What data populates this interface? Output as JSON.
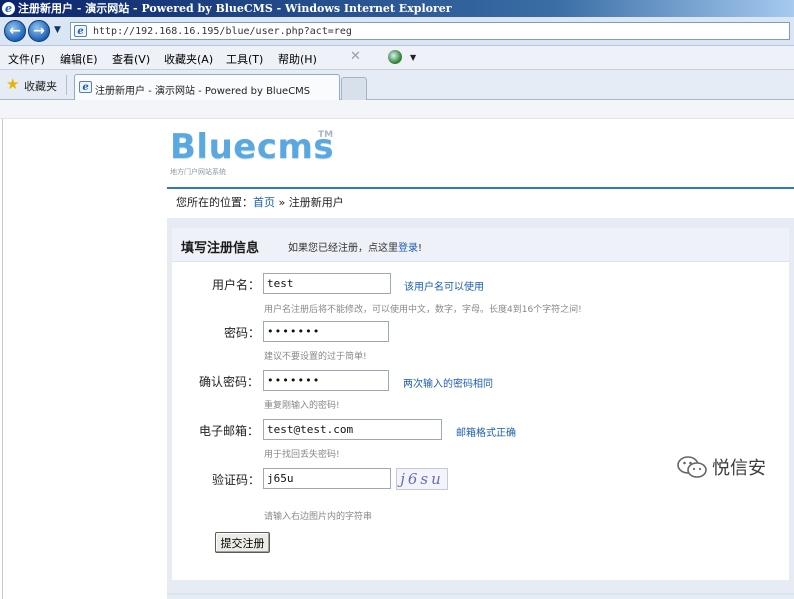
{
  "window": {
    "title": "注册新用户 - 演示网站 - Powered by BlueCMS - Windows Internet Explorer"
  },
  "address": {
    "url": "http://192.168.16.195/blue/user.php?act=reg"
  },
  "menu": {
    "items": [
      "文件(F)",
      "编辑(E)",
      "查看(V)",
      "收藏夹(A)",
      "工具(T)",
      "帮助(H)"
    ]
  },
  "favorites": {
    "label": "收藏夹",
    "tab_title": "注册新用户 - 演示网站 - Powered by BlueCMS"
  },
  "site": {
    "logo": "Bluecms",
    "logo_tm": "TM",
    "tagline": "地方门户网站系统"
  },
  "breadcrumb": {
    "prefix": "您所在的位置：",
    "home": "首页",
    "sep": " » ",
    "current": "注册新用户"
  },
  "register": {
    "title": "填写注册信息",
    "hint_text": "如果您已经注册，点这里",
    "hint_link": "登录",
    "hint_end": "!",
    "username_label": "用户名：",
    "username_value": "test",
    "username_status": "该用户名可以使用",
    "username_hint": "用户名注册后将不能修改，可以使用中文，数字，字母。长度4到16个字符之间!",
    "password_label": "密码：",
    "password_value": "•••••••",
    "password_hint": "建议不要设置的过于简单!",
    "confirm_label": "确认密码：",
    "confirm_value": "•••••••",
    "confirm_status": "两次输入的密码相同",
    "confirm_hint": "重复刚输入的密码!",
    "email_label": "电子邮箱：",
    "email_value": "test@test.com",
    "email_status": "邮箱格式正确",
    "email_hint": "用于找回丢失密码!",
    "captcha_label": "验证码：",
    "captcha_value": "j65u",
    "captcha_image_text": "j6su",
    "captcha_hint": "请输入右边图片内的字符串",
    "submit_label": "提交注册"
  },
  "watermark": {
    "text": "悦信安"
  },
  "colors": {
    "link": "#1c5fb0",
    "accent": "#2f7bc0",
    "logo": "#5aa8df"
  }
}
